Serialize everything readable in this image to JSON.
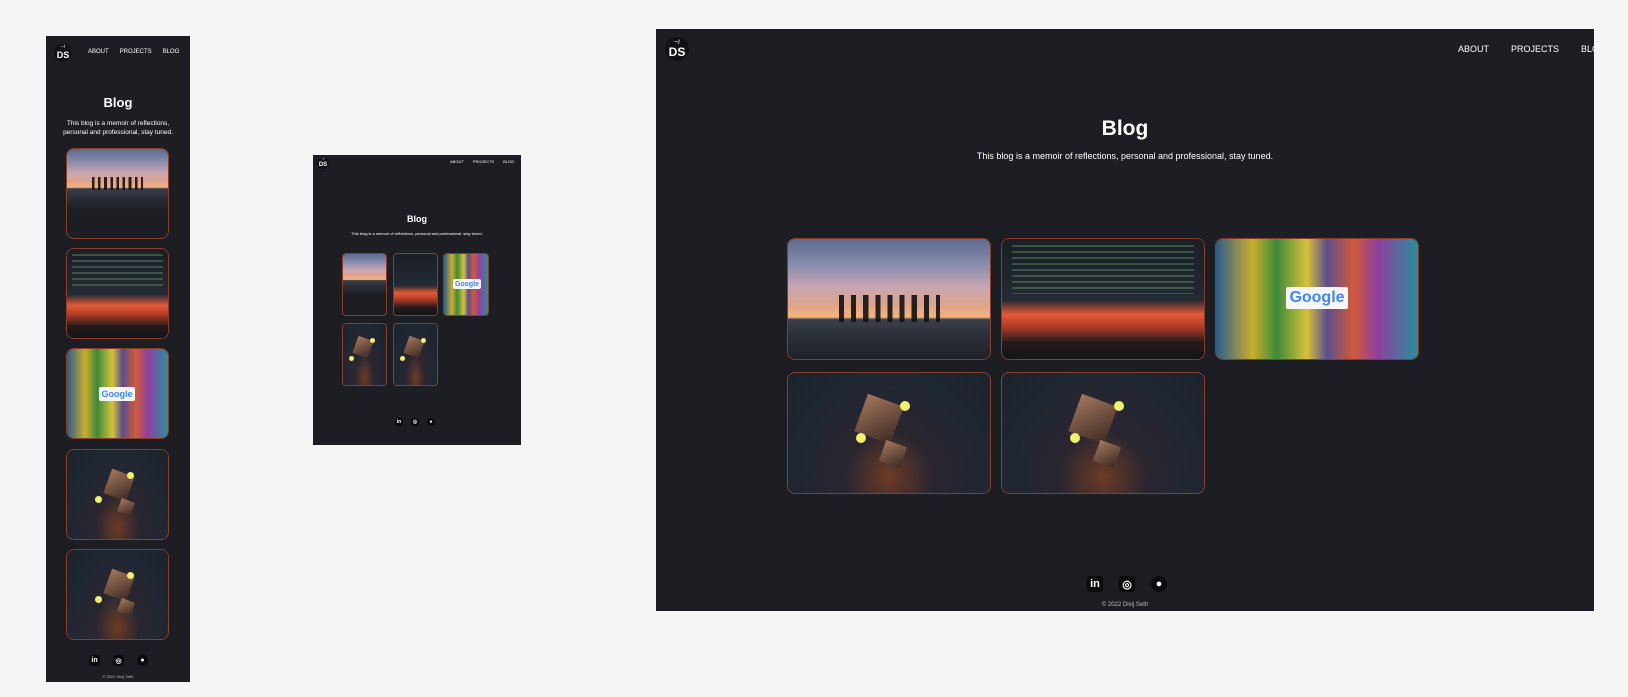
{
  "site": {
    "logo_text": "DS",
    "logo_top": "~/",
    "nav": [
      "ABOUT",
      "PROJECTS",
      "BLOG"
    ],
    "page_title": "Blog",
    "subtitle": "This blog is a memoir of reflections, personal and professional, stay tuned.",
    "subtitle_mobile_line1": "This blog is a memoir of reflections,",
    "subtitle_mobile_line2": "personal and professional, stay tuned.",
    "google_sign": "Google",
    "social": [
      {
        "icon": "linkedin-icon",
        "glyph": "in"
      },
      {
        "icon": "instagram-icon",
        "glyph": "◎"
      },
      {
        "icon": "github-icon",
        "glyph": "●"
      }
    ],
    "copyright": "© 2022 Divij Seth"
  },
  "posts": [
    {
      "image": "sunset-beach"
    },
    {
      "image": "code-screens"
    },
    {
      "image": "google-graffiti"
    },
    {
      "image": "floating-cubes"
    },
    {
      "image": "floating-cubes"
    }
  ]
}
